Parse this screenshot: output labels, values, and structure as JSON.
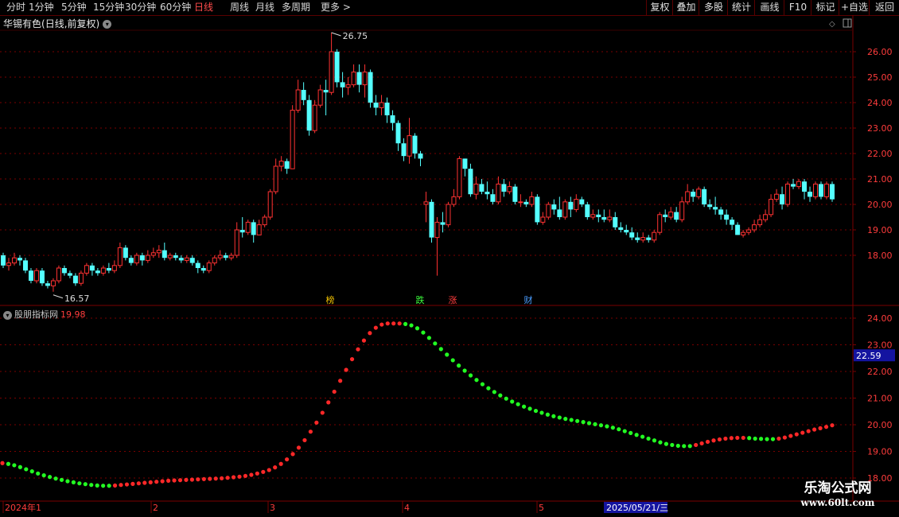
{
  "toolbar": {
    "periods": [
      "分时",
      "1分钟",
      "5分钟",
      "15分钟",
      "30分钟",
      "60分钟",
      "日线",
      "周线",
      "月线",
      "多周期",
      "更多 >"
    ],
    "active_period": "日线",
    "right_buttons": [
      "复权",
      "叠加",
      "多股",
      "统计",
      "画线",
      "F10",
      "标记",
      "+自选",
      "返回"
    ]
  },
  "stock": {
    "name": "华锡有色",
    "mode": "(日线,前复权)",
    "high_label": "26.75",
    "low_label": "16.57"
  },
  "markers": [
    {
      "text": "榜",
      "color": "#f0c000"
    },
    {
      "text": "跌",
      "color": "#3cff3c"
    },
    {
      "text": "涨",
      "color": "#ff3c3c"
    },
    {
      "text": "财",
      "color": "#4a9cff"
    }
  ],
  "indicator": {
    "name": "股朋指标网",
    "value": "19.98",
    "current_label": "22.59"
  },
  "colors": {
    "up": "#ff3232",
    "down": "#54ffff",
    "grid": "#7a0000",
    "axis": "#7a0000",
    "ind_up": "#ff2828",
    "ind_down": "#22ff22"
  },
  "chart_data": [
    {
      "type": "candlestick",
      "title": "华锡有色(日线,前复权)",
      "y_ticks": [
        "26.00",
        "25.00",
        "24.00",
        "23.00",
        "22.00",
        "21.00",
        "20.00",
        "19.00",
        "18.00"
      ],
      "ylim": [
        16.2,
        27.0
      ],
      "annotations": [
        {
          "text": "26.75",
          "kind": "max"
        },
        {
          "text": "16.57",
          "kind": "min"
        }
      ],
      "x_labels": [
        "2024年1",
        "2",
        "3",
        "4",
        "5",
        "2025/05/21/三"
      ],
      "candles": [
        [
          18.0,
          17.6,
          18.1,
          17.5
        ],
        [
          17.6,
          17.7,
          17.9,
          17.4
        ],
        [
          17.7,
          17.9,
          18.1,
          17.6
        ],
        [
          17.9,
          17.8,
          18.0,
          17.6
        ],
        [
          17.8,
          17.4,
          17.9,
          17.3
        ],
        [
          17.4,
          17.0,
          17.5,
          16.9
        ],
        [
          17.0,
          17.4,
          17.5,
          16.9
        ],
        [
          17.4,
          16.9,
          17.5,
          16.8
        ],
        [
          16.9,
          16.8,
          17.0,
          16.7
        ],
        [
          16.8,
          17.0,
          17.1,
          16.57
        ],
        [
          17.0,
          17.5,
          17.6,
          16.9
        ],
        [
          17.5,
          17.3,
          17.6,
          17.2
        ],
        [
          17.3,
          17.2,
          17.4,
          17.1
        ],
        [
          17.2,
          16.9,
          17.3,
          16.8
        ],
        [
          16.9,
          17.3,
          17.4,
          16.8
        ],
        [
          17.3,
          17.6,
          17.7,
          17.2
        ],
        [
          17.6,
          17.4,
          17.7,
          17.2
        ],
        [
          17.4,
          17.3,
          17.5,
          17.2
        ],
        [
          17.3,
          17.5,
          17.6,
          17.2
        ],
        [
          17.5,
          17.4,
          17.7,
          17.3
        ],
        [
          17.4,
          17.6,
          17.8,
          17.3
        ],
        [
          17.6,
          18.3,
          18.5,
          17.5
        ],
        [
          18.3,
          17.9,
          18.4,
          17.8
        ],
        [
          17.9,
          17.7,
          18.0,
          17.6
        ],
        [
          17.7,
          18.0,
          18.1,
          17.6
        ],
        [
          18.0,
          17.8,
          18.1,
          17.6
        ],
        [
          17.8,
          18.0,
          18.2,
          17.7
        ],
        [
          18.0,
          18.1,
          18.3,
          17.9
        ],
        [
          18.1,
          18.2,
          18.4,
          17.9
        ],
        [
          18.2,
          17.9,
          18.5,
          17.8
        ],
        [
          17.9,
          18.0,
          18.1,
          17.8
        ],
        [
          18.0,
          17.9,
          18.1,
          17.8
        ],
        [
          17.9,
          17.8,
          18.0,
          17.7
        ],
        [
          17.8,
          17.9,
          18.0,
          17.7
        ],
        [
          17.9,
          17.7,
          18.0,
          17.6
        ],
        [
          17.7,
          17.5,
          17.8,
          17.3
        ],
        [
          17.5,
          17.4,
          17.6,
          17.3
        ],
        [
          17.4,
          17.7,
          17.8,
          17.3
        ],
        [
          17.7,
          17.9,
          18.0,
          17.6
        ],
        [
          17.9,
          18.0,
          18.2,
          17.8
        ],
        [
          18.0,
          17.9,
          18.1,
          17.8
        ],
        [
          17.9,
          18.0,
          18.1,
          17.8
        ],
        [
          18.0,
          19.0,
          19.3,
          17.9
        ],
        [
          19.0,
          18.9,
          19.5,
          18.7
        ],
        [
          18.9,
          19.3,
          19.4,
          18.8
        ],
        [
          19.3,
          18.8,
          19.4,
          18.5
        ],
        [
          18.8,
          19.2,
          19.4,
          18.8
        ],
        [
          19.2,
          19.5,
          19.6,
          19.1
        ],
        [
          19.5,
          20.5,
          20.6,
          19.4
        ],
        [
          20.5,
          21.5,
          21.8,
          20.4
        ],
        [
          21.5,
          21.7,
          21.9,
          21.3
        ],
        [
          21.7,
          21.4,
          21.8,
          21.2
        ],
        [
          21.4,
          23.7,
          23.9,
          21.4
        ],
        [
          23.7,
          24.5,
          24.9,
          23.6
        ],
        [
          24.5,
          24.1,
          24.8,
          23.9
        ],
        [
          24.1,
          22.9,
          24.3,
          22.7
        ],
        [
          22.9,
          23.9,
          24.1,
          22.8
        ],
        [
          23.9,
          24.5,
          24.7,
          23.8
        ],
        [
          24.5,
          24.4,
          24.9,
          23.5
        ],
        [
          24.4,
          26.0,
          26.75,
          24.3
        ],
        [
          26.0,
          24.8,
          26.1,
          24.6
        ],
        [
          24.8,
          24.6,
          25.2,
          24.2
        ],
        [
          24.6,
          24.7,
          25.0,
          24.3
        ],
        [
          24.7,
          25.2,
          25.5,
          24.6
        ],
        [
          25.2,
          24.7,
          25.5,
          24.4
        ],
        [
          24.7,
          25.2,
          25.5,
          24.2
        ],
        [
          25.2,
          24.0,
          25.3,
          23.8
        ],
        [
          24.0,
          23.8,
          24.3,
          23.5
        ],
        [
          23.8,
          24.0,
          24.3,
          23.5
        ],
        [
          24.0,
          23.5,
          24.2,
          23.2
        ],
        [
          23.5,
          23.2,
          23.7,
          22.9
        ],
        [
          23.2,
          22.4,
          23.3,
          22.1
        ],
        [
          22.4,
          21.9,
          22.6,
          21.7
        ],
        [
          21.9,
          22.7,
          23.4,
          21.6
        ],
        [
          22.7,
          22.0,
          22.8,
          21.8
        ],
        [
          22.0,
          21.8,
          22.1,
          21.5
        ],
        [
          20.0,
          20.1,
          20.5,
          19.3
        ],
        [
          20.1,
          18.7,
          20.2,
          18.5
        ],
        [
          18.7,
          19.3,
          19.5,
          17.2
        ],
        [
          19.3,
          19.2,
          19.7,
          18.9
        ],
        [
          19.2,
          20.0,
          20.1,
          19.1
        ],
        [
          20.0,
          20.3,
          20.6,
          19.9
        ],
        [
          20.3,
          21.8,
          21.9,
          20.2
        ],
        [
          21.8,
          21.4,
          21.8,
          21.1
        ],
        [
          21.4,
          20.4,
          21.6,
          20.3
        ],
        [
          20.4,
          20.8,
          21.1,
          20.2
        ],
        [
          20.8,
          20.5,
          21.0,
          20.4
        ],
        [
          20.5,
          20.4,
          20.9,
          20.2
        ],
        [
          20.4,
          20.1,
          20.6,
          20.0
        ],
        [
          20.1,
          20.8,
          21.1,
          20.0
        ],
        [
          20.8,
          20.5,
          21.0,
          20.3
        ],
        [
          20.5,
          20.7,
          20.9,
          20.4
        ],
        [
          20.7,
          20.1,
          20.8,
          20.0
        ],
        [
          20.1,
          20.1,
          20.4,
          19.9
        ],
        [
          20.1,
          20.0,
          20.2,
          19.9
        ],
        [
          20.0,
          20.3,
          20.5,
          19.9
        ],
        [
          20.3,
          19.3,
          20.4,
          19.2
        ],
        [
          19.3,
          19.5,
          19.7,
          19.2
        ],
        [
          19.5,
          20.0,
          20.1,
          19.4
        ],
        [
          20.0,
          19.8,
          20.2,
          19.6
        ],
        [
          19.8,
          19.5,
          20.3,
          19.4
        ],
        [
          19.5,
          20.1,
          20.2,
          19.4
        ],
        [
          20.1,
          19.8,
          20.3,
          19.5
        ],
        [
          19.8,
          20.2,
          20.4,
          19.7
        ],
        [
          20.2,
          20.0,
          20.3,
          19.9
        ],
        [
          20.0,
          19.5,
          20.1,
          19.4
        ],
        [
          19.5,
          19.6,
          19.8,
          19.4
        ],
        [
          19.6,
          19.5,
          19.8,
          19.3
        ],
        [
          19.5,
          19.4,
          19.8,
          19.3
        ],
        [
          19.4,
          19.5,
          19.8,
          19.3
        ],
        [
          19.5,
          19.1,
          19.7,
          19.0
        ],
        [
          19.1,
          19.0,
          19.3,
          18.9
        ],
        [
          19.0,
          18.9,
          19.2,
          18.8
        ],
        [
          18.9,
          18.7,
          19.1,
          18.6
        ],
        [
          18.7,
          18.6,
          18.9,
          18.5
        ],
        [
          18.6,
          18.7,
          18.9,
          18.5
        ],
        [
          18.7,
          18.6,
          18.8,
          18.5
        ],
        [
          18.6,
          18.9,
          19.0,
          18.5
        ],
        [
          18.9,
          19.6,
          19.7,
          18.8
        ],
        [
          19.6,
          19.5,
          19.8,
          19.3
        ],
        [
          19.5,
          19.7,
          19.9,
          19.4
        ],
        [
          19.7,
          19.4,
          19.9,
          19.3
        ],
        [
          19.4,
          20.1,
          20.3,
          19.3
        ],
        [
          20.1,
          20.5,
          20.8,
          20.0
        ],
        [
          20.5,
          20.3,
          20.6,
          20.1
        ],
        [
          20.3,
          20.6,
          20.7,
          20.2
        ],
        [
          20.6,
          20.0,
          20.7,
          19.9
        ],
        [
          20.0,
          19.9,
          20.2,
          19.8
        ],
        [
          19.9,
          19.8,
          20.3,
          19.6
        ],
        [
          19.8,
          19.6,
          19.9,
          19.4
        ],
        [
          19.6,
          19.4,
          19.8,
          19.2
        ],
        [
          19.4,
          19.2,
          19.5,
          19.0
        ],
        [
          19.2,
          18.8,
          19.3,
          18.8
        ],
        [
          18.8,
          18.9,
          19.0,
          18.7
        ],
        [
          18.9,
          19.0,
          19.1,
          18.8
        ],
        [
          19.0,
          19.2,
          19.4,
          18.9
        ],
        [
          19.2,
          19.4,
          19.6,
          19.1
        ],
        [
          19.4,
          19.6,
          19.8,
          19.3
        ],
        [
          19.6,
          20.2,
          20.4,
          19.5
        ],
        [
          20.2,
          20.4,
          20.6,
          20.1
        ],
        [
          20.4,
          20.0,
          20.7,
          19.8
        ],
        [
          20.0,
          20.8,
          20.9,
          19.9
        ],
        [
          20.8,
          20.7,
          21.0,
          20.6
        ],
        [
          20.7,
          20.9,
          21.0,
          20.6
        ],
        [
          20.9,
          20.5,
          21.0,
          20.2
        ],
        [
          20.5,
          20.3,
          20.7,
          20.1
        ],
        [
          20.3,
          20.8,
          20.9,
          20.2
        ],
        [
          20.8,
          20.3,
          20.9,
          20.2
        ],
        [
          20.3,
          20.8,
          20.9,
          20.2
        ],
        [
          20.8,
          20.2,
          20.9,
          20.1
        ]
      ]
    },
    {
      "type": "line",
      "title": "股朋指标网",
      "y_ticks": [
        "24.00",
        "23.00",
        "22.00",
        "21.00",
        "20.00",
        "19.00",
        "18.00"
      ],
      "ylim": [
        17.6,
        24.3
      ],
      "value": 19.98,
      "series": [
        {
          "name": "股朋指标网",
          "values": [
            18.56,
            18.53,
            18.48,
            18.41,
            18.33,
            18.25,
            18.17,
            18.1,
            18.04,
            17.98,
            17.93,
            17.88,
            17.84,
            17.8,
            17.77,
            17.74,
            17.72,
            17.71,
            17.71,
            17.72,
            17.74,
            17.76,
            17.78,
            17.8,
            17.82,
            17.84,
            17.86,
            17.88,
            17.9,
            17.91,
            17.92,
            17.93,
            17.94,
            17.95,
            17.96,
            17.97,
            17.98,
            17.99,
            18.01,
            18.03,
            18.05,
            18.08,
            18.12,
            18.17,
            18.23,
            18.3,
            18.4,
            18.53,
            18.7,
            18.9,
            19.14,
            19.42,
            19.74,
            20.08,
            20.45,
            20.84,
            21.24,
            21.65,
            22.06,
            22.46,
            22.83,
            23.16,
            23.44,
            23.64,
            23.76,
            23.8,
            23.8,
            23.8,
            23.78,
            23.73,
            23.62,
            23.46,
            23.26,
            23.05,
            22.84,
            22.63,
            22.42,
            22.22,
            22.03,
            21.85,
            21.68,
            21.52,
            21.37,
            21.23,
            21.1,
            20.98,
            20.87,
            20.77,
            20.68,
            20.6,
            20.52,
            20.45,
            20.38,
            20.32,
            20.27,
            20.22,
            20.18,
            20.14,
            20.1,
            20.06,
            20.02,
            19.98,
            19.94,
            19.89,
            19.83,
            19.76,
            19.69,
            19.62,
            19.55,
            19.48,
            19.41,
            19.34,
            19.28,
            19.24,
            19.21,
            19.2,
            19.2,
            19.24,
            19.3,
            19.36,
            19.41,
            19.45,
            19.48,
            19.5,
            19.51,
            19.51,
            19.5,
            19.48,
            19.47,
            19.46,
            19.46,
            19.48,
            19.52,
            19.58,
            19.64,
            19.7,
            19.76,
            19.82,
            19.87,
            19.92,
            19.98
          ]
        }
      ]
    }
  ]
}
